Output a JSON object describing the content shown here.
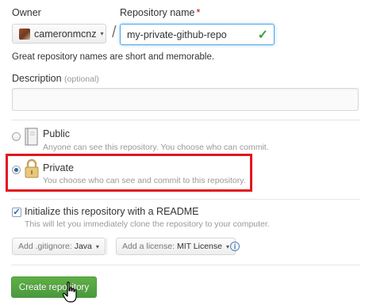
{
  "owner": {
    "label": "Owner",
    "value": "cameronmcnz",
    "caret": "▾"
  },
  "repo": {
    "label": "Repository name",
    "required_mark": "*",
    "value": "my-private-github-repo",
    "valid_icon": "check-icon"
  },
  "hint": "Great repository names are short and memorable.",
  "description": {
    "label": "Description",
    "optional": "(optional)",
    "value": ""
  },
  "visibility": {
    "public": {
      "title": "Public",
      "note": "Anyone can see this repository. You choose who can commit.",
      "selected": false,
      "icon": "book-icon"
    },
    "private": {
      "title": "Private",
      "note": "You choose who can see and commit to this repository.",
      "selected": true,
      "icon": "lock-icon"
    },
    "highlight_color": "#e3141f"
  },
  "readme": {
    "checked": true,
    "label": "Initialize this repository with a README",
    "note": "This will let you immediately clone the repository to your computer."
  },
  "gitignore": {
    "prefix": "Add .gitignore:",
    "value": "Java",
    "caret": "▾"
  },
  "license": {
    "prefix": "Add a license:",
    "value": "MIT License",
    "caret": "▾"
  },
  "info_icon": "i",
  "create_button": {
    "label": "Create repository",
    "color": "#4a993e"
  }
}
